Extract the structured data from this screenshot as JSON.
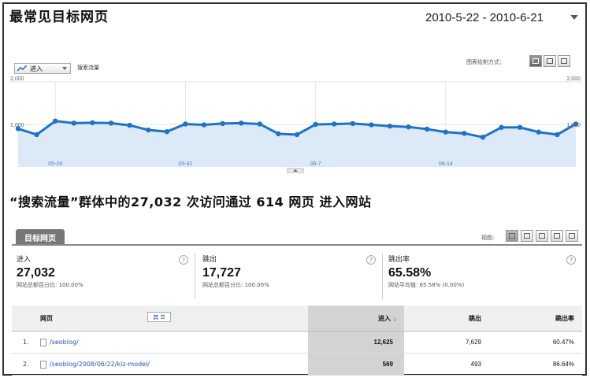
{
  "report": {
    "title": "最常见目标网页",
    "date_range": "2010-5-22 - 2010-6-21"
  },
  "graph_controls": {
    "metric_label": "进入",
    "segment_label": "搜索流量",
    "mode_label": "图表绘制方式：",
    "modes": [
      "day-view-icon",
      "week-view-icon",
      "month-view-icon"
    ]
  },
  "chart_data": {
    "type": "line",
    "y_left_top_label": "2,000",
    "y_left_mid_label": "1,000",
    "y_right_top_label": "2,000",
    "y_right_mid_label": "1,000",
    "ylim": [
      0,
      2000
    ],
    "x_tick_labels": [
      "05-24",
      "05-31",
      "06-7",
      "06-14"
    ],
    "x_tick_indices": [
      2,
      9,
      16,
      23
    ],
    "x": [
      "05-22",
      "05-23",
      "05-24",
      "05-25",
      "05-26",
      "05-27",
      "05-28",
      "05-29",
      "05-30",
      "05-31",
      "06-01",
      "06-02",
      "06-03",
      "06-04",
      "06-05",
      "06-06",
      "06-07",
      "06-08",
      "06-09",
      "06-10",
      "06-11",
      "06-12",
      "06-13",
      "06-14",
      "06-15",
      "06-16",
      "06-17",
      "06-18",
      "06-19",
      "06-20",
      "06-21"
    ],
    "series": [
      {
        "values": [
          900,
          760,
          1080,
          1030,
          1040,
          1030,
          980,
          870,
          830,
          1010,
          990,
          1020,
          1030,
          1010,
          780,
          760,
          1000,
          1010,
          1020,
          990,
          960,
          940,
          890,
          820,
          790,
          700,
          930,
          930,
          820,
          760,
          1010
        ]
      }
    ],
    "grid": true,
    "fill": "area"
  },
  "summary": "“搜索流量”群体中的27,032 次访问通过 614 网页 进入网站",
  "tabs": {
    "target_pages": "目标网页",
    "view_label": "视图:"
  },
  "stats": [
    {
      "name": "进入",
      "value": "27,032",
      "sub": "网站总额百分比: 100.00%"
    },
    {
      "name": "跳出",
      "value": "17,727",
      "sub": "网站总额百分比: 100.00%"
    },
    {
      "name": "跳出率",
      "value": "65.58%",
      "sub": "网站平均值: 65.58% (0.00%)"
    }
  ],
  "table": {
    "headers": {
      "page": "网页",
      "entrances": "进入",
      "bounces": "跳出",
      "bounce_rate": "跳出率"
    },
    "filter_label": "其",
    "rows": [
      {
        "num": "1.",
        "page": "/seoblog/",
        "entrances": "12,625",
        "bounces": "7,629",
        "bounce_rate": "60.47%"
      },
      {
        "num": "2.",
        "page": "/seoblog/2008/06/22/kiz-model/",
        "entrances": "569",
        "bounces": "493",
        "bounce_rate": "86.64%"
      }
    ]
  },
  "colors": {
    "line": "#1f73c7",
    "fill": "#dceaf7",
    "tab_bg": "#777777"
  }
}
